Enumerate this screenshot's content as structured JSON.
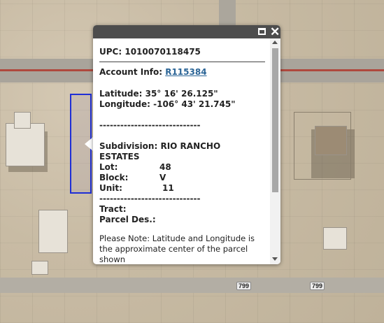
{
  "popup": {
    "upc_label": "UPC:",
    "upc_value": "1010070118475",
    "account_label": "Account Info:",
    "account_value": "R115384",
    "latitude_label": "Latitude:",
    "latitude_value": "35° 16' 26.125\"",
    "longitude_label": "Longitude:",
    "longitude_value": "-106° 43' 21.745\"",
    "divider1": "-----------------------------",
    "subdivision_label": "Subdivision:",
    "subdivision_value_line1": "RIO RANCHO",
    "subdivision_value_line2": "ESTATES",
    "lot_label": "Lot:",
    "lot_value": "48",
    "block_label": "Block:",
    "block_value": "V",
    "unit_label": "Unit:",
    "unit_value": "11",
    "divider2": "-----------------------------",
    "tract_label": "Tract:",
    "parcel_des_label": "Parcel Des.:",
    "note": "Please Note: Latitude and Longitude is the approximate center of the parcel shown"
  },
  "map": {
    "road_labels": [
      "799",
      "799"
    ],
    "parcel_border_color": "#1f2fd6"
  },
  "icons": {
    "maximize": "maximize-icon",
    "close": "close-icon"
  }
}
